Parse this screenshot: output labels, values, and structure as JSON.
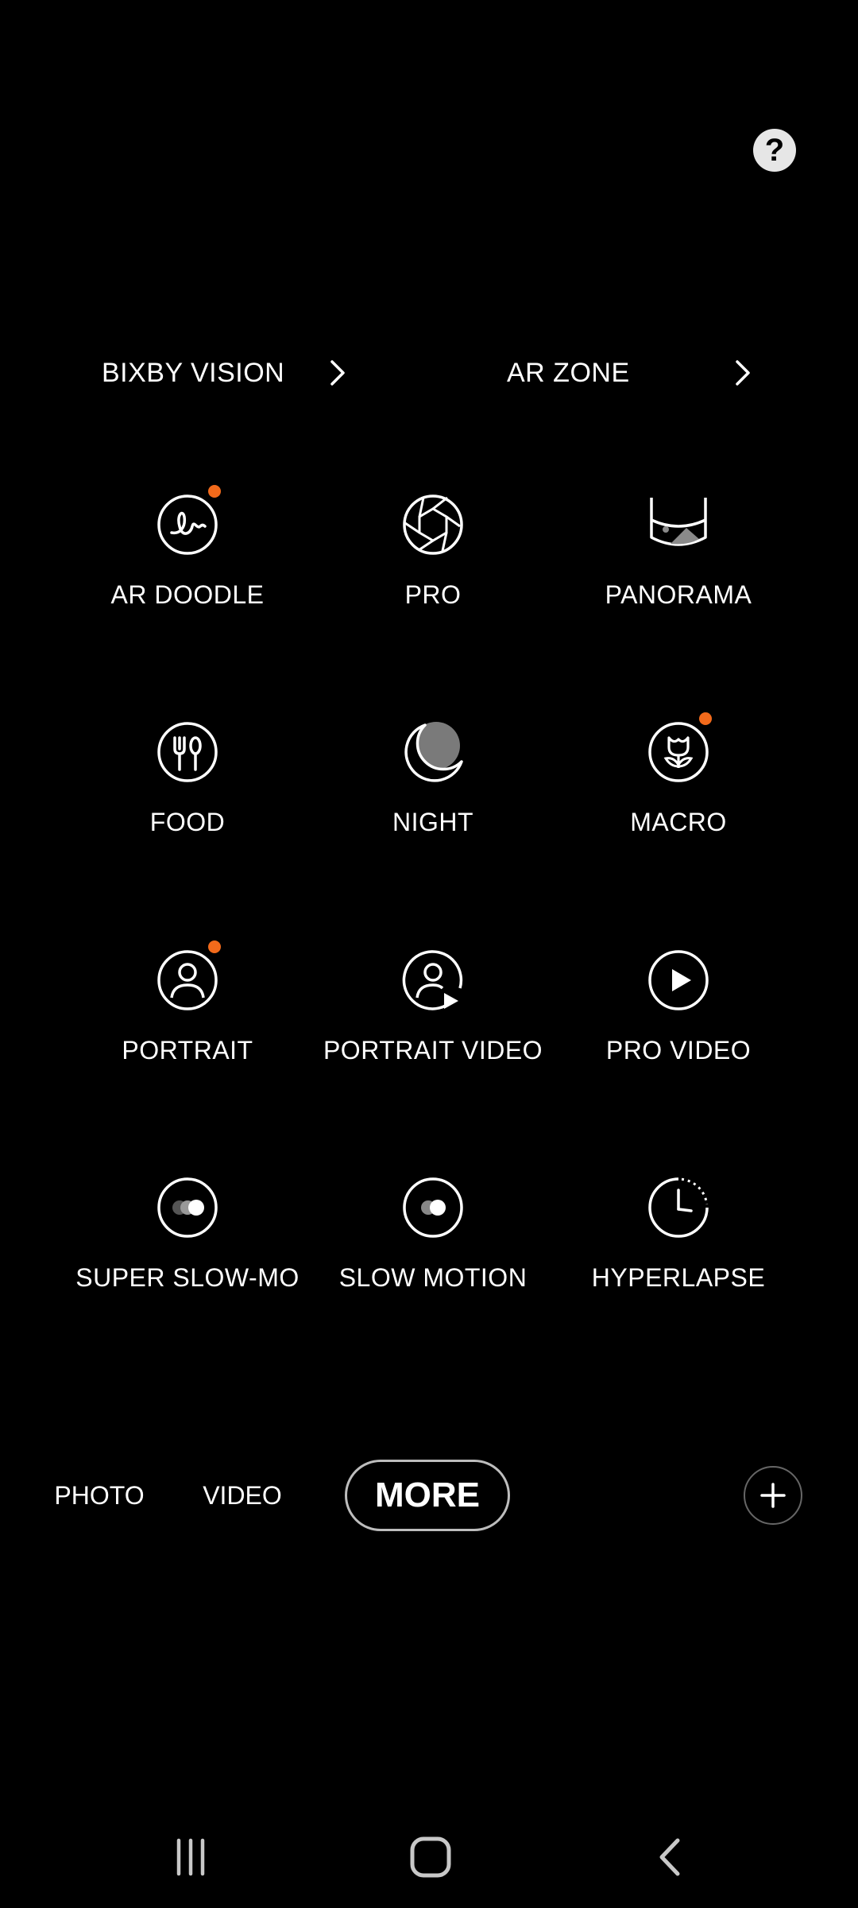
{
  "header": {
    "help_icon": "question-mark-icon",
    "help_label": "?"
  },
  "links": [
    {
      "label": "BIXBY VISION",
      "icon": "chevron-right-icon"
    },
    {
      "label": "AR ZONE",
      "icon": "chevron-right-icon"
    }
  ],
  "modes": [
    {
      "label": "AR DOODLE",
      "icon": "ar-doodle-icon",
      "new_indicator": true
    },
    {
      "label": "PRO",
      "icon": "aperture-icon",
      "new_indicator": false
    },
    {
      "label": "PANORAMA",
      "icon": "panorama-icon",
      "new_indicator": false
    },
    {
      "label": "FOOD",
      "icon": "fork-spoon-icon",
      "new_indicator": false
    },
    {
      "label": "NIGHT",
      "icon": "moon-icon",
      "new_indicator": false
    },
    {
      "label": "MACRO",
      "icon": "flower-icon",
      "new_indicator": true
    },
    {
      "label": "PORTRAIT",
      "icon": "person-icon",
      "new_indicator": true
    },
    {
      "label": "PORTRAIT VIDEO",
      "icon": "person-play-icon",
      "new_indicator": false
    },
    {
      "label": "PRO VIDEO",
      "icon": "play-icon",
      "new_indicator": false
    },
    {
      "label": "SUPER SLOW-MO",
      "icon": "super-slow-mo-icon",
      "new_indicator": false
    },
    {
      "label": "SLOW MOTION",
      "icon": "slow-motion-icon",
      "new_indicator": false
    },
    {
      "label": "HYPERLAPSE",
      "icon": "timer-icon",
      "new_indicator": false
    }
  ],
  "mode_bar": {
    "tabs": [
      {
        "label": "PHOTO",
        "selected": false
      },
      {
        "label": "VIDEO",
        "selected": false
      },
      {
        "label": "MORE",
        "selected": true
      }
    ],
    "add_icon": "plus-icon"
  },
  "nav": {
    "recent_icon": "recent-apps-icon",
    "home_icon": "home-icon",
    "back_icon": "back-icon"
  },
  "colors": {
    "background": "#000000",
    "text": "#ffffff",
    "indicator": "#f26a1b",
    "help_bg": "#e6e6e6"
  }
}
